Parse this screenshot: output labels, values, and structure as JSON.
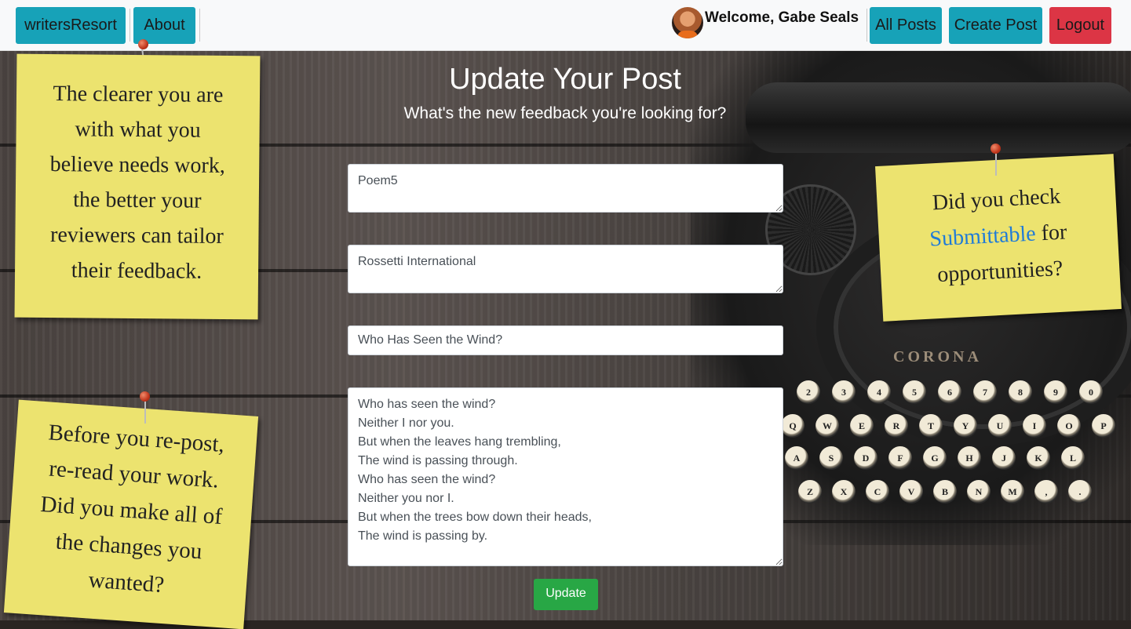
{
  "nav": {
    "brand": "writersResort",
    "about": "About",
    "welcome": "Welcome, Gabe Seals",
    "all_posts": "All Posts",
    "create_post": "Create Post",
    "logout": "Logout"
  },
  "page": {
    "title": "Update Your Post",
    "subtitle": "What's the new feedback you're looking for?"
  },
  "form": {
    "field1": "Poem5",
    "field2": "Rossetti International",
    "title_value": "Who Has Seen the Wind?",
    "body": "Who has seen the wind?\nNeither I nor you.\nBut when the leaves hang trembling,\nThe wind is passing through.\nWho has seen the wind?\nNeither you nor I.\nBut when the trees bow down their heads,\nThe wind is passing by.",
    "submit": "Update"
  },
  "notes": {
    "note1_lines": [
      "The clearer you are",
      "with what you",
      "believe needs work,",
      "the better your",
      "reviewers can tailor",
      "their feedback."
    ],
    "note2_pre": "Did you check",
    "note2_link": "Submittable",
    "note2_post": "for",
    "note2_last": "opportunities?",
    "note3_lines": [
      "Before you re-post,",
      "re-read your work.",
      "Did you make all of",
      "the changes you",
      "wanted?"
    ]
  },
  "typewriter": {
    "brand": "CORONA",
    "keys_row1": [
      "2",
      "3",
      "4",
      "5",
      "6",
      "7",
      "8",
      "9",
      "0"
    ],
    "keys_row2": [
      "Q",
      "W",
      "E",
      "R",
      "T",
      "Y",
      "U",
      "I",
      "O",
      "P"
    ],
    "keys_row3": [
      "A",
      "S",
      "D",
      "F",
      "G",
      "H",
      "J",
      "K",
      "L"
    ],
    "keys_row4": [
      "Z",
      "X",
      "C",
      "V",
      "B",
      "N",
      "M",
      ",",
      "."
    ]
  },
  "colors": {
    "info": "#17a2b8",
    "danger": "#dc3545",
    "success": "#28a745",
    "note": "#ece36f"
  }
}
